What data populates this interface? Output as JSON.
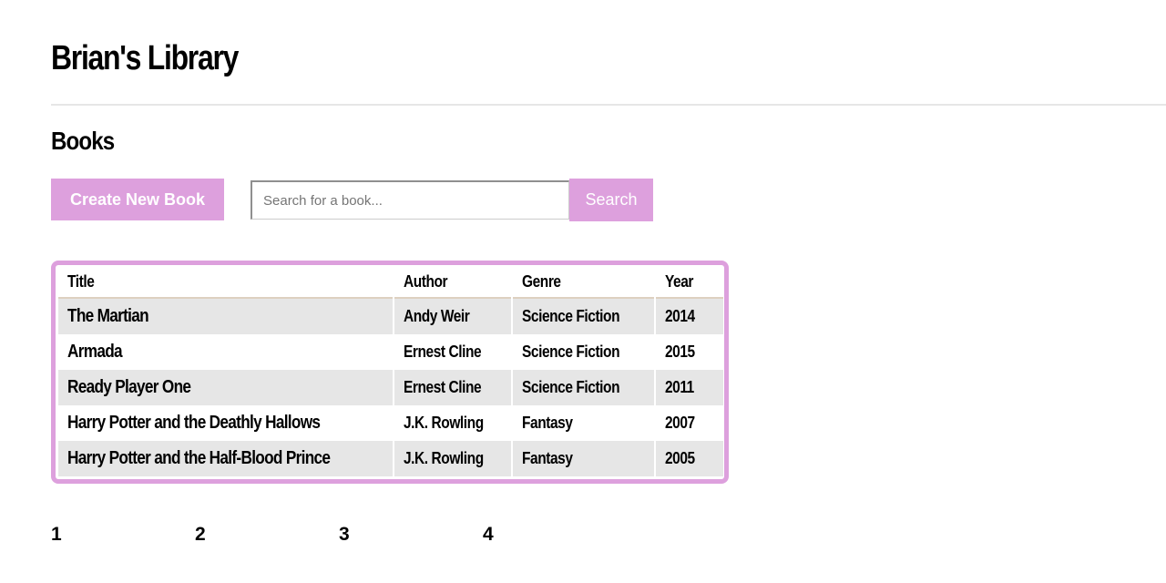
{
  "header": {
    "title": "Brian's Library"
  },
  "main": {
    "section_title": "Books",
    "create_button_label": "Create New Book",
    "search": {
      "placeholder": "Search for a book...",
      "value": "",
      "button_label": "Search"
    },
    "table": {
      "columns": [
        "Title",
        "Author",
        "Genre",
        "Year"
      ],
      "rows": [
        {
          "title": "The Martian",
          "author": "Andy Weir",
          "genre": "Science Fiction",
          "year": "2014"
        },
        {
          "title": "Armada",
          "author": "Ernest Cline",
          "genre": "Science Fiction",
          "year": "2015"
        },
        {
          "title": "Ready Player One",
          "author": "Ernest Cline",
          "genre": "Science Fiction",
          "year": "2011"
        },
        {
          "title": "Harry Potter and the Deathly Hallows",
          "author": "J.K. Rowling",
          "genre": "Fantasy",
          "year": "2007"
        },
        {
          "title": "Harry Potter and the Half-Blood Prince",
          "author": "J.K. Rowling",
          "genre": "Fantasy",
          "year": "2005"
        }
      ]
    },
    "pagination": {
      "pages": [
        "1",
        "2",
        "3",
        "4"
      ]
    }
  },
  "colors": {
    "accent": "#dda0dd",
    "row_shade": "#e6e6e6",
    "divider": "#e6e6e6"
  }
}
